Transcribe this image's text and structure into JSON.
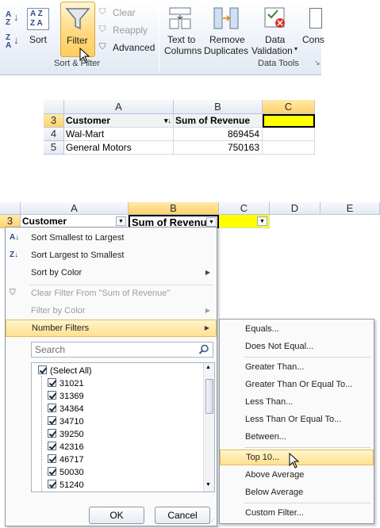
{
  "ribbon": {
    "sort_az_label": "A Z",
    "sort_label": "Sort",
    "filter_label": "Filter",
    "clear_label": "Clear",
    "reapply_label": "Reapply",
    "advanced_label": "Advanced",
    "sort_filter_group": "Sort & Filter",
    "text_to_columns": [
      "Text to",
      "Columns"
    ],
    "remove_duplicates": [
      "Remove",
      "Duplicates"
    ],
    "data_validation": [
      "Data",
      "Validation"
    ],
    "consolidate_label": "Cons",
    "data_tools_group": "Data Tools"
  },
  "sheet_top": {
    "columns": [
      "A",
      "B",
      "C"
    ],
    "rows": [
      {
        "num": "3",
        "a": "Customer",
        "b": "Sum of Revenue",
        "c": ""
      },
      {
        "num": "4",
        "a": "Wal-Mart",
        "b": "869454",
        "c": ""
      },
      {
        "num": "5",
        "a": "General Motors",
        "b": "750163",
        "c": ""
      }
    ]
  },
  "sheet_bottom": {
    "columns": [
      "A",
      "B",
      "C",
      "D",
      "E"
    ],
    "row_num": "3",
    "a_header": "Customer",
    "b_header": "Sum of Revenue"
  },
  "menu": {
    "sort_small": "Sort Smallest to Largest",
    "sort_large": "Sort Largest to Smallest",
    "sort_color": "Sort by Color",
    "clear_filter": "Clear Filter From \"Sum of Revenue\"",
    "filter_color": "Filter by Color",
    "number_filters": "Number Filters",
    "search_placeholder": "Search",
    "values": [
      "(Select All)",
      "31021",
      "31369",
      "34364",
      "34710",
      "39250",
      "42316",
      "46717",
      "50030",
      "51240"
    ],
    "ok": "OK",
    "cancel": "Cancel"
  },
  "submenu": {
    "items": [
      "Equals...",
      "Does Not Equal...",
      "Greater Than...",
      "Greater Than Or Equal To...",
      "Less Than...",
      "Less Than Or Equal To...",
      "Between...",
      "Top 10...",
      "Above Average",
      "Below Average",
      "Custom Filter..."
    ]
  },
  "colors": {
    "selected_cell": "#ffff00",
    "highlight": "#ffe18e",
    "header_selected": "#ffd26b"
  }
}
